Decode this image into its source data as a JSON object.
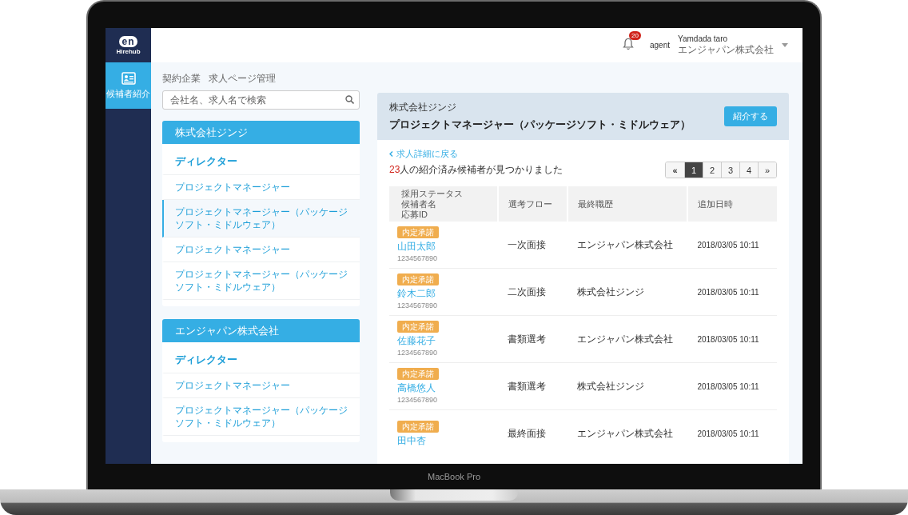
{
  "app": {
    "logo": "en",
    "logo_sub": "Hirehub"
  },
  "sidebar": {
    "items": [
      {
        "label": "候補者紹介",
        "selected": true
      }
    ]
  },
  "header": {
    "notifications": "20",
    "role": "agent",
    "user_name": "Yamdada taro",
    "company": "エンジャパン株式会社"
  },
  "breadcrumb": [
    "契約企業",
    "求人ページ管理"
  ],
  "search": {
    "placeholder": "会社名、求人名で検索"
  },
  "companies": [
    {
      "name": "株式会社ジンジ",
      "jobs": [
        {
          "title": "ディレクター",
          "kind": "primary",
          "selected": false
        },
        {
          "title": "プロジェクトマネージャー",
          "kind": "job",
          "selected": false
        },
        {
          "title": "プロジェクトマネージャー（パッケージソフト・ミドルウェア）",
          "kind": "job",
          "selected": true
        },
        {
          "title": "プロジェクトマネージャー",
          "kind": "job",
          "selected": false
        },
        {
          "title": "プロジェクトマネージャー（パッケージソフト・ミドルウェア）",
          "kind": "job",
          "selected": false
        }
      ]
    },
    {
      "name": "エンジャパン株式会社",
      "jobs": [
        {
          "title": "ディレクター",
          "kind": "primary",
          "selected": false
        },
        {
          "title": "プロジェクトマネージャー",
          "kind": "job",
          "selected": false
        },
        {
          "title": "プロジェクトマネージャー（パッケージソフト・ミドルウェア）",
          "kind": "job",
          "selected": false
        }
      ]
    }
  ],
  "job": {
    "company": "株式会社ジンジ",
    "title": "プロジェクトマネージャー（パッケージソフト・ミドルウェア）",
    "button": "紹介する"
  },
  "back_link": "求人詳細に戻る",
  "result": {
    "count": "23",
    "text": "人の紹介済み候補者が見つかりました"
  },
  "pagination": [
    {
      "label": "«",
      "selected": false
    },
    {
      "label": "1",
      "selected": true
    },
    {
      "label": "2",
      "selected": false
    },
    {
      "label": "3",
      "selected": false
    },
    {
      "label": "4",
      "selected": false
    },
    {
      "label": "»",
      "selected": false
    }
  ],
  "table": {
    "columns": [
      [
        "採用ステータス",
        "候補者名",
        "応募ID"
      ],
      [
        "選考フロー"
      ],
      [
        "最終職歴"
      ],
      [
        "追加日時"
      ]
    ],
    "rows": [
      {
        "status": "内定承諾",
        "name": "山田太郎",
        "id": "1234567890",
        "flow": "一次面接",
        "last_job": "エンジャパン株式会社",
        "added": "2018/03/05 10:11"
      },
      {
        "status": "内定承諾",
        "name": "鈴木二郎",
        "id": "1234567890",
        "flow": "二次面接",
        "last_job": "株式会社ジンジ",
        "added": "2018/03/05 10:11"
      },
      {
        "status": "内定承諾",
        "name": "佐藤花子",
        "id": "1234567890",
        "flow": "書類選考",
        "last_job": "エンジャパン株式会社",
        "added": "2018/03/05 10:11"
      },
      {
        "status": "内定承諾",
        "name": "高橋悠人",
        "id": "1234567890",
        "flow": "書類選考",
        "last_job": "株式会社ジンジ",
        "added": "2018/03/05 10:11"
      },
      {
        "status": "内定承諾",
        "name": "田中杏",
        "flow": "最終面接",
        "last_job": "エンジャパン株式会社",
        "added": "2018/03/05 10:11"
      }
    ]
  },
  "device_label": "MacBook Pro"
}
